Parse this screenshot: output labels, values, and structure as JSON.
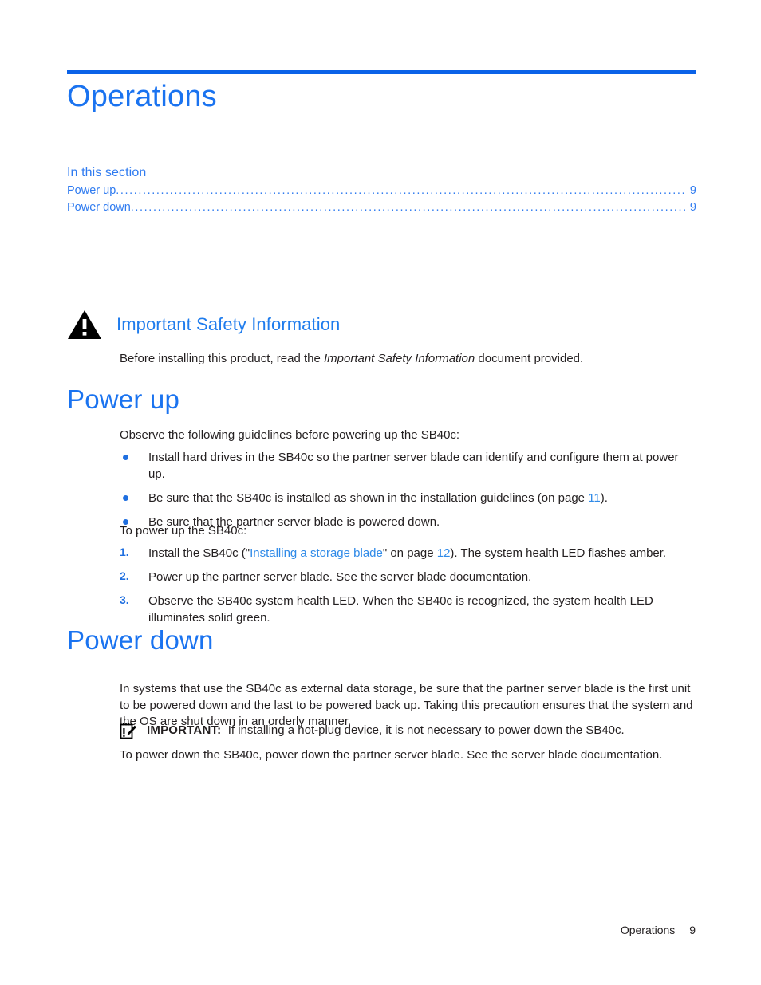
{
  "document": {
    "chapter_title": "Operations",
    "footer": {
      "section_label": "Operations",
      "page_number": "9"
    }
  },
  "toc": {
    "heading": "In this section",
    "entries": [
      {
        "label": "Power up",
        "dots": "................................................................................................................................................",
        "page": "9"
      },
      {
        "label": "Power down ",
        "dots": "..............................................................................................................................................",
        "page": "9"
      }
    ]
  },
  "safety_notice": {
    "icon": "warning-triangle-icon",
    "title": "Important Safety Information",
    "body_before": "Before installing this product, read the ",
    "body_italic": "Important Safety Information",
    "body_after": " document provided."
  },
  "power_up": {
    "heading": "Power up",
    "intro": "Observe the following guidelines before powering up the SB40c:",
    "bullets": [
      {
        "text": "Install hard drives in the SB40c so the partner server blade can identify and configure them at power up."
      },
      {
        "before": "Be sure that the SB40c is installed as shown in the installation guidelines (on page ",
        "link": "11",
        "after": ")."
      },
      {
        "text": "Be sure that the partner server blade is powered down."
      }
    ],
    "steps_intro": "To power up the SB40c:",
    "steps": [
      {
        "number": "1.",
        "before": "Install the SB40c (\"",
        "link_text": "Installing a storage blade",
        "mid": "\" on page ",
        "link_page": "12",
        "after": "). The system health LED flashes amber."
      },
      {
        "number": "2.",
        "before": "Power up the partner server blade. See the server blade documentation.",
        "link_text": "",
        "mid": "",
        "link_page": "",
        "after": ""
      },
      {
        "number": "3.",
        "before": "Observe the SB40c system health LED. When the SB40c is recognized, the system health LED illuminates solid green.",
        "link_text": "",
        "mid": "",
        "link_page": "",
        "after": ""
      }
    ]
  },
  "power_down": {
    "heading": "Power down",
    "paragraph": "In systems that use the SB40c as external data storage, be sure that the partner server blade is the first unit to be powered down and the last to be powered back up. Taking this precaution ensures that the system and the OS are shut down in an orderly manner.",
    "note": {
      "icon": "notepad-pencil-icon",
      "label": "IMPORTANT:",
      "text": "If installing a hot-plug device, it is not necessary to power down the SB40c."
    },
    "closing": "To power down the SB40c, power down the partner server blade. See the server blade documentation."
  },
  "colors": {
    "heading_blue": "#1a73f0",
    "rule_blue": "#0a62e8",
    "link_blue": "#2f8ae8",
    "bullet_blue": "#1f6fe0",
    "body_black": "#231f20"
  }
}
